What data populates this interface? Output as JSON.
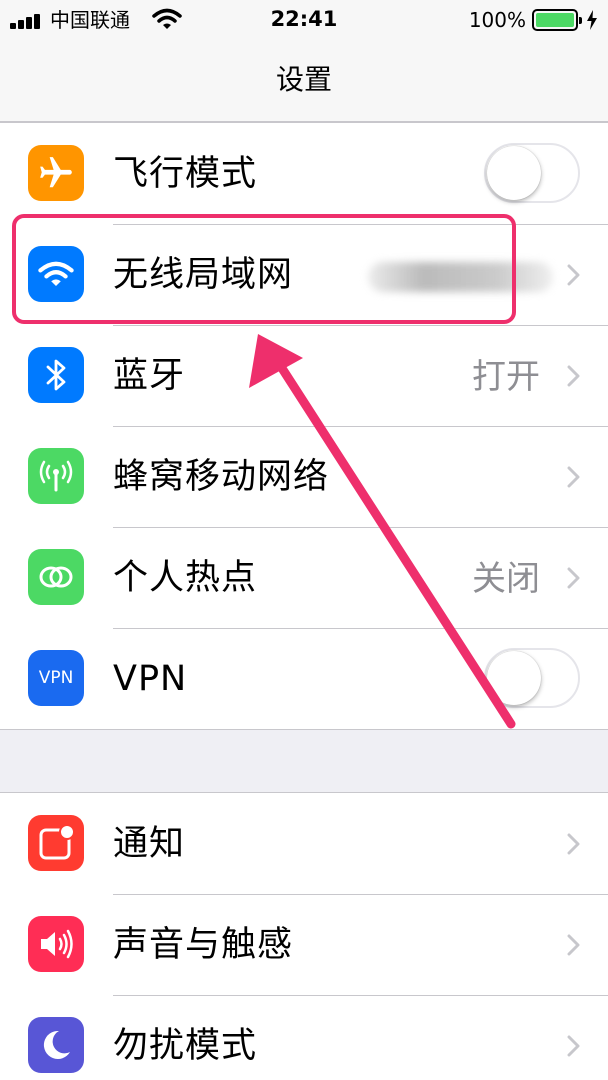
{
  "status_bar": {
    "carrier": "中国联通",
    "time": "22:41",
    "battery_percent": "100%",
    "battery_level": 1.0,
    "icons": [
      "signal-icon",
      "wifi-icon",
      "battery-icon",
      "charging-icon"
    ]
  },
  "nav": {
    "title": "设置"
  },
  "group1": {
    "airplane": {
      "label": "飞行模式",
      "icon": "airplane-icon",
      "color": "#ff9500",
      "toggle_on": false
    },
    "wifi": {
      "label": "无线局域网",
      "icon": "wifi-icon",
      "color": "#007aff"
    },
    "bluetooth": {
      "label": "蓝牙",
      "value": "打开",
      "icon": "bluetooth-icon",
      "color": "#007aff"
    },
    "cellular": {
      "label": "蜂窝移动网络",
      "icon": "cellular-antenna-icon",
      "color": "#4cd964"
    },
    "hotspot": {
      "label": "个人热点",
      "value": "关闭",
      "icon": "hotspot-link-icon",
      "color": "#4cd964"
    },
    "vpn": {
      "label": "VPN",
      "icon_text": "VPN",
      "icon": "vpn-icon",
      "color": "#1a6af0",
      "toggle_on": false
    }
  },
  "group2": {
    "notifications": {
      "label": "通知",
      "icon": "notification-icon",
      "color": "#ff3b30"
    },
    "sounds": {
      "label": "声音与触感",
      "icon": "speaker-icon",
      "color": "#ff2d55"
    },
    "dnd": {
      "label": "勿扰模式",
      "icon": "moon-icon",
      "color": "#5856d6"
    }
  },
  "annotation": {
    "color": "#ee2f6c"
  }
}
